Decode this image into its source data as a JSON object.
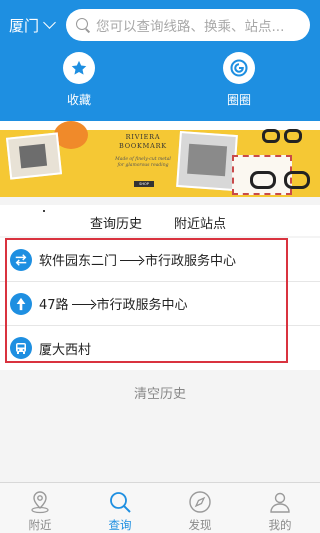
{
  "header": {
    "city": "厦门",
    "search_placeholder": "您可以查询线路、换乘、站点..."
  },
  "quick_actions": [
    {
      "label": "收藏",
      "icon": "star-icon"
    },
    {
      "label": "圈圈",
      "icon": "circle-logo-icon"
    }
  ],
  "banner": {
    "title": "RIVIERA BOOKMARK",
    "subtitle": "Made of finely-cut metal for glamorous reading",
    "cta": "SHOP"
  },
  "tabs": [
    {
      "label": "查询历史",
      "active": true
    },
    {
      "label": "附近站点",
      "active": false
    }
  ],
  "history": [
    {
      "type": "transfer",
      "icon": "transfer-icon",
      "from": "软件园东二门",
      "to": "市行政服务中心"
    },
    {
      "type": "route",
      "icon": "navigation-icon",
      "from": "47路",
      "to": "市行政服务中心"
    },
    {
      "type": "station",
      "icon": "bus-icon",
      "from": "厦大西村",
      "to": ""
    }
  ],
  "clear_label": "清空历史",
  "bottom_nav": [
    {
      "label": "附近",
      "icon": "location-pin-icon",
      "active": false
    },
    {
      "label": "查询",
      "icon": "search-icon",
      "active": true
    },
    {
      "label": "发现",
      "icon": "compass-icon",
      "active": false
    },
    {
      "label": "我的",
      "icon": "user-icon",
      "active": false
    }
  ],
  "colors": {
    "primary": "#1e8fe1",
    "highlight_border": "#d9333f",
    "banner_yellow": "#f5c834"
  }
}
